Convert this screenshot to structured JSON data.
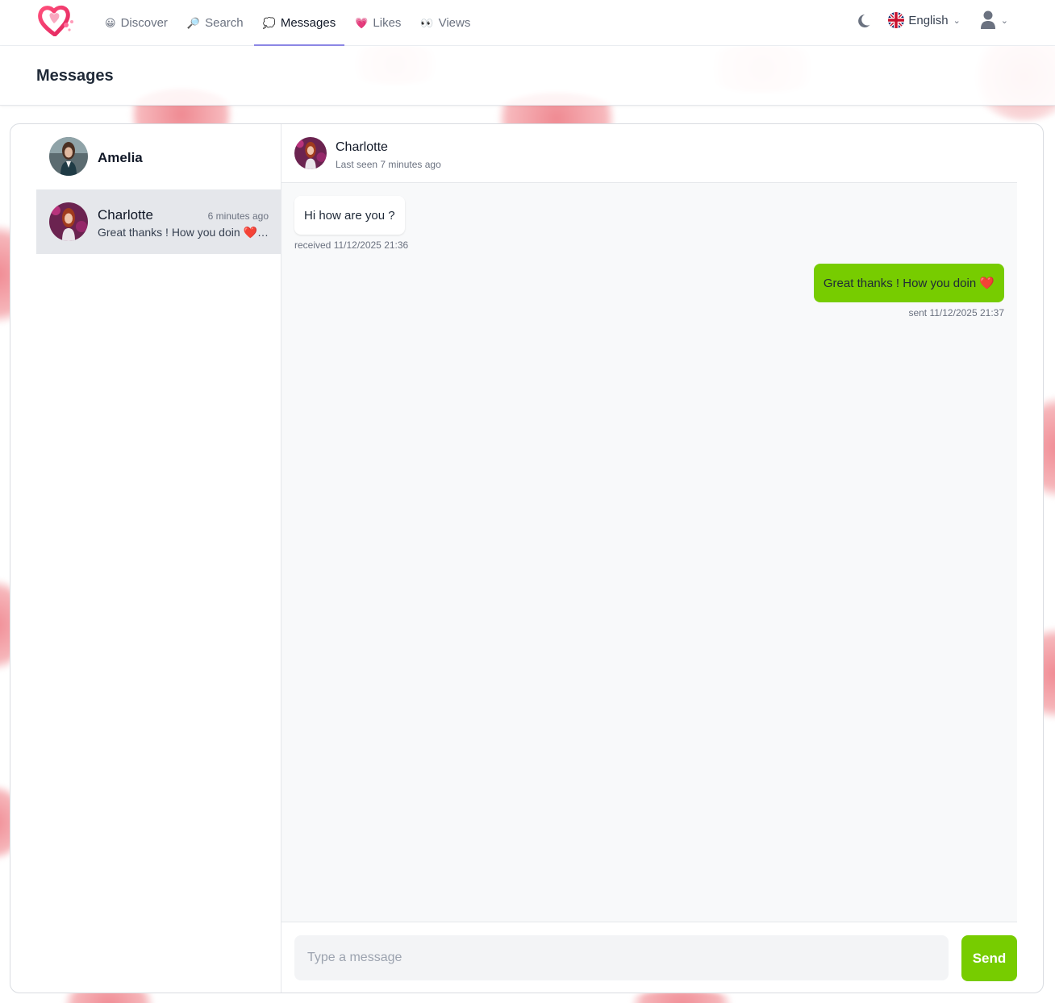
{
  "nav": {
    "items": [
      {
        "label": "Discover",
        "icon": "😀"
      },
      {
        "label": "Search",
        "icon": "🔎"
      },
      {
        "label": "Messages",
        "icon": "💭"
      },
      {
        "label": "Likes",
        "icon": "💗"
      },
      {
        "label": "Views",
        "icon": "👀"
      }
    ],
    "active": "Messages",
    "language": "English"
  },
  "page": {
    "title": "Messages"
  },
  "conversations": [
    {
      "name": "Amelia",
      "time": "",
      "preview": ""
    },
    {
      "name": "Charlotte",
      "time": "6 minutes ago",
      "preview": "Great thanks ! How you doin ❤️ ..."
    }
  ],
  "chat": {
    "name": "Charlotte",
    "status": "Last seen 7 minutes ago",
    "messages": [
      {
        "text": "Hi how are you ?",
        "meta": "received 11/12/2025 21:36"
      },
      {
        "text": "Great thanks ! How you doin ❤️",
        "meta": "sent 11/12/2025 21:37"
      }
    ],
    "input_placeholder": "Type a message",
    "send_label": "Send"
  },
  "colors": {
    "accent": "#77cc00",
    "nav_active": "#8d88e6",
    "selected_row": "#e5e7eb"
  }
}
